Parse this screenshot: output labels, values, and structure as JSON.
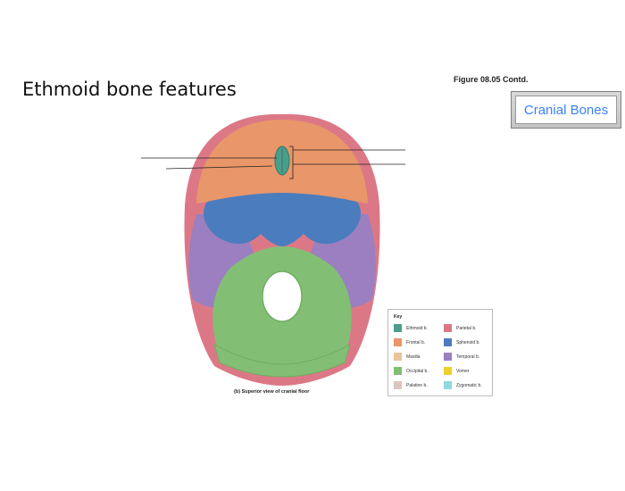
{
  "slide": {
    "title": "Ethmoid bone features",
    "figure_label": "Figure 08.05 Contd.",
    "nav_button": "Cranial Bones"
  },
  "diagram": {
    "caption_part": "(b)",
    "caption_text": "Superior view of cranial floor",
    "key": {
      "title": "Key",
      "items": [
        {
          "label": "Ethmoid b.",
          "color": "#4a9e8a"
        },
        {
          "label": "Frontal b.",
          "color": "#e8966a"
        },
        {
          "label": "Maxilla",
          "color": "#e9c49c"
        },
        {
          "label": "Occipital b.",
          "color": "#82bf74"
        },
        {
          "label": "Palatine b.",
          "color": "#dcc5bd"
        },
        {
          "label": "Parietal b.",
          "color": "#dc7886"
        },
        {
          "label": "Sphenoid b.",
          "color": "#4b7cbd"
        },
        {
          "label": "Temporal b.",
          "color": "#9b7fc0"
        },
        {
          "label": "Vomer",
          "color": "#ecd12a"
        },
        {
          "label": "Zygomatic b.",
          "color": "#8ed9de"
        }
      ]
    }
  }
}
